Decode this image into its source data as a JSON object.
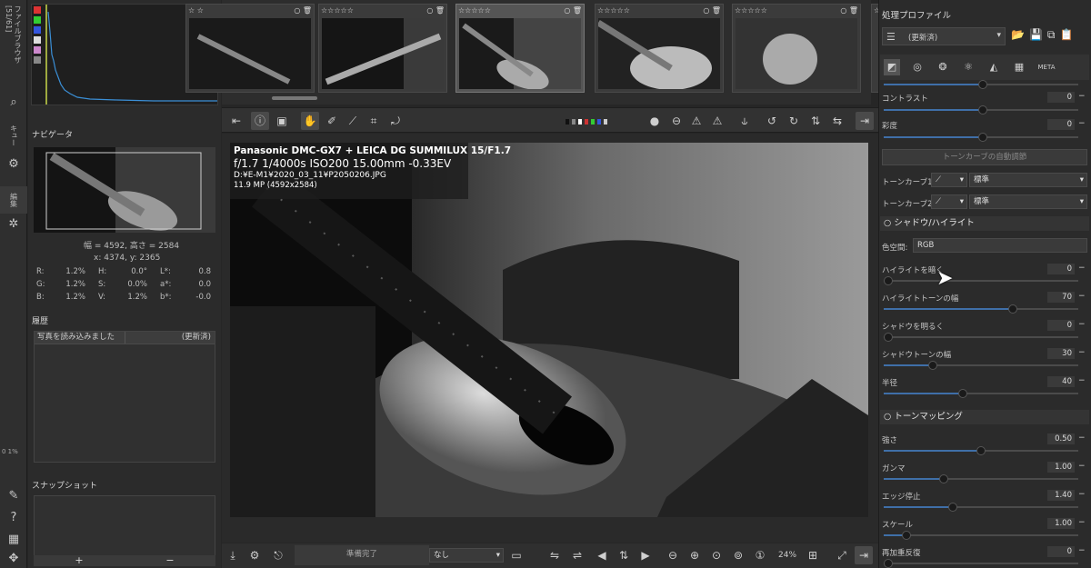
{
  "vtabs": {
    "file_browser": "ファイルブラウザ [51/61]",
    "queue": "キュー",
    "editor": "編集"
  },
  "left": {
    "navigator_title": "ナビゲータ",
    "dimensions": "幅 = 4592, 高さ = 2584",
    "coords": "x: 4374, y: 2365",
    "readout": [
      {
        "a": "R:",
        "av": "1.2%",
        "b": "H:",
        "bv": "0.0°",
        "c": "L*:",
        "cv": "0.8"
      },
      {
        "a": "G:",
        "av": "1.2%",
        "b": "S:",
        "bv": "0.0%",
        "c": "a*:",
        "cv": "0.0"
      },
      {
        "a": "B:",
        "av": "1.2%",
        "b": "V:",
        "bv": "1.2%",
        "c": "b*:",
        "cv": "-0.0"
      }
    ],
    "history_title": "履歴",
    "history_rows": [
      {
        "action": "写真を読み込みました",
        "state": "(更新済)"
      }
    ],
    "snapshot_title": "スナップショット",
    "snap_add": "+",
    "snap_remove": "−",
    "zoom_small": "0 1%"
  },
  "info": {
    "camera": "Panasonic DMC-GX7 + LEICA DG SUMMILUX 15/F1.7",
    "exposure": "f/1.7  1/4000s  ISO200  15.00mm  -0.33EV",
    "path": "D:¥E-M1¥2020_03_11¥P2050206.JPG",
    "size": "11.9 MP (4592x2584)"
  },
  "bottom": {
    "status": "準備完了",
    "select_value": "なし",
    "zoom": "24%"
  },
  "right": {
    "profile_title": "処理プロファイル",
    "profile_value": "(更新済)",
    "contrast_label": "コントラスト",
    "contrast_val": "0",
    "saturation_label": "彩度",
    "saturation_val": "0",
    "auto_tone": "トーンカーブの自動調節",
    "tc1_label": "トーンカーブ1:",
    "tc1_val": "標準",
    "tc2_label": "トーンカーブ2:",
    "tc2_val": "標準",
    "sh_title": "シャドウ/ハイライト",
    "colorspace_label": "色空間:",
    "colorspace_val": "RGB",
    "sliders1": [
      {
        "label": "ハイライトを暗く",
        "value": "0",
        "frac": 0.0
      },
      {
        "label": "ハイライトトーンの幅",
        "value": "70",
        "frac": 0.67
      },
      {
        "label": "シャドウを明るく",
        "value": "0",
        "frac": 0.0
      },
      {
        "label": "シャドウトーンの幅",
        "value": "30",
        "frac": 0.24
      },
      {
        "label": "半径",
        "value": "40",
        "frac": 0.4
      }
    ],
    "tm_title": "トーンマッピング",
    "sliders2": [
      {
        "label": "強さ",
        "value": "0.50",
        "frac": 0.5
      },
      {
        "label": "ガンマ",
        "value": "1.00",
        "frac": 0.3
      },
      {
        "label": "エッジ停止",
        "value": "1.40",
        "frac": 0.35
      },
      {
        "label": "スケール",
        "value": "1.00",
        "frac": 0.1
      },
      {
        "label": "再加重反復",
        "value": "0",
        "frac": 0.0
      }
    ],
    "meta_label": "META"
  }
}
